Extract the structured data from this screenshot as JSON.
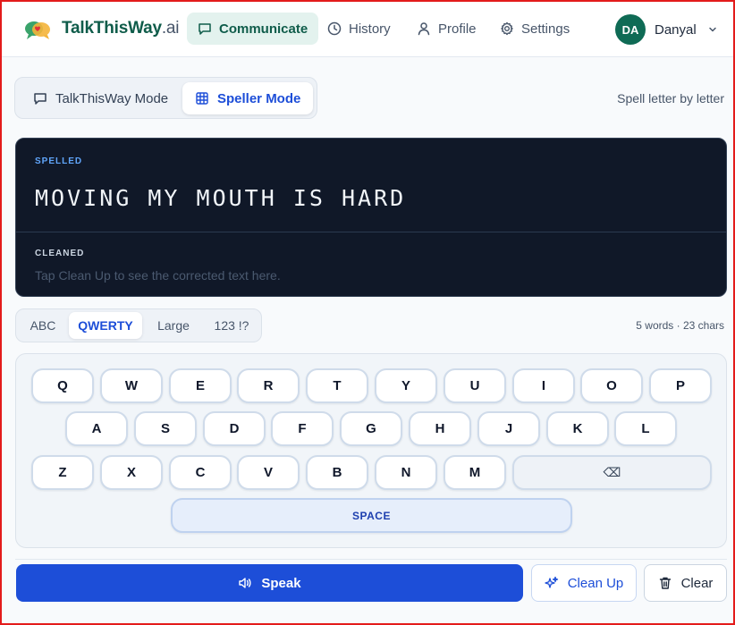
{
  "header": {
    "brand_name": "TalkThisWay",
    "brand_suffix": ".ai",
    "nav": [
      {
        "label": "Communicate",
        "icon": "message-square-icon",
        "active": true
      },
      {
        "label": "History",
        "icon": "clock-icon",
        "active": false
      },
      {
        "label": "Profile",
        "icon": "user-icon",
        "active": false
      },
      {
        "label": "Settings",
        "icon": "gear-icon",
        "active": false
      }
    ],
    "user": {
      "initials": "DA",
      "name": "Danyal"
    }
  },
  "modes": {
    "items": [
      {
        "label": "TalkThisWay Mode",
        "icon": "message-square-icon",
        "active": false
      },
      {
        "label": "Speller Mode",
        "icon": "grid-icon",
        "active": true
      }
    ],
    "hint": "Spell letter by letter"
  },
  "output": {
    "spelled_label": "SPELLED",
    "spelled_text": "MOVING MY MOUTH IS HARD",
    "cleaned_label": "CLEANED",
    "cleaned_placeholder": "Tap Clean Up to see the corrected text here."
  },
  "layouts": {
    "items": [
      {
        "label": "ABC",
        "active": false
      },
      {
        "label": "QWERTY",
        "active": true
      },
      {
        "label": "Large",
        "active": false
      },
      {
        "label": "123 !?",
        "active": false
      }
    ],
    "counts": "5 words · 23 chars"
  },
  "keyboard": {
    "rows": [
      [
        "Q",
        "W",
        "E",
        "R",
        "T",
        "Y",
        "U",
        "I",
        "O",
        "P"
      ],
      [
        "A",
        "S",
        "D",
        "F",
        "G",
        "H",
        "J",
        "K",
        "L"
      ],
      [
        "Z",
        "X",
        "C",
        "V",
        "B",
        "N",
        "M"
      ]
    ],
    "backspace_label": "⌫",
    "space_label": "SPACE"
  },
  "actions": {
    "speak_label": "Speak",
    "cleanup_label": "Clean Up",
    "clear_label": "Clear"
  },
  "colors": {
    "brand": "#0f5c4a",
    "accent": "#1d4ed8",
    "output_bg": "#101828",
    "frame_border": "#e31b1b"
  }
}
